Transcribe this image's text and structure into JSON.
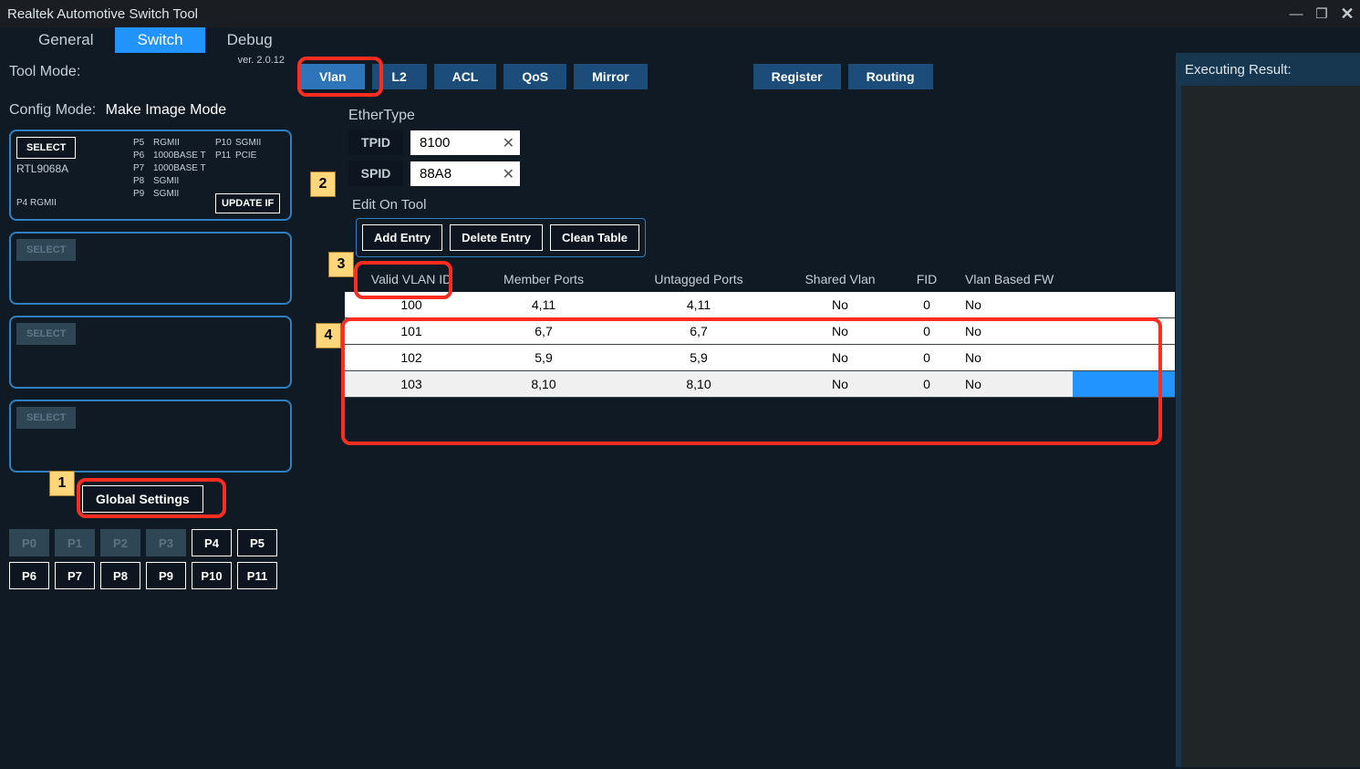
{
  "window": {
    "title": "Realtek Automotive Switch Tool"
  },
  "winbtns": {
    "min": "—",
    "max": "❐",
    "close": "✕"
  },
  "main_tabs": {
    "general": "General",
    "switch": "Switch",
    "debug": "Debug"
  },
  "sidebar": {
    "tool_mode_label": "Tool Mode:",
    "version": "ver. 2.0.12",
    "config_mode_label": "Config Mode:",
    "config_mode_value": "Make Image Mode",
    "select": "SELECT",
    "device": "RTL9068A",
    "p4_row": "P4  RGMII",
    "ports_col": [
      {
        "p": "P5",
        "v": "RGMII"
      },
      {
        "p": "P6",
        "v": "1000BASE T"
      },
      {
        "p": "P7",
        "v": "1000BASE T"
      },
      {
        "p": "P8",
        "v": "SGMII"
      },
      {
        "p": "P9",
        "v": "SGMII"
      }
    ],
    "ports_col2": [
      {
        "p": "P10",
        "v": "SGMII"
      },
      {
        "p": "P11",
        "v": "PCIE"
      }
    ],
    "update_if": "UPDATE IF",
    "global_settings": "Global Settings",
    "port_buttons": [
      "P0",
      "P1",
      "P2",
      "P3",
      "P4",
      "P5",
      "P6",
      "P7",
      "P8",
      "P9",
      "P10",
      "P11"
    ]
  },
  "callouts": {
    "c1": "1",
    "c2": "2",
    "c3": "3",
    "c4": "4"
  },
  "subtabs": {
    "vlan": "Vlan",
    "l2": "L2",
    "acl": "ACL",
    "qos": "QoS",
    "mirror": "Mirror",
    "register": "Register",
    "routing": "Routing"
  },
  "ethertype": {
    "section": "EtherType",
    "tpid_label": "TPID",
    "tpid_value": "8100",
    "spid_label": "SPID",
    "spid_value": "88A8",
    "clear": "✕"
  },
  "edit": {
    "section": "Edit On Tool",
    "add": "Add Entry",
    "delete": "Delete Entry",
    "clean": "Clean Table"
  },
  "table": {
    "headers": {
      "vlan": "Valid VLAN ID",
      "members": "Member Ports",
      "untagged": "Untagged Ports",
      "shared": "Shared Vlan",
      "fid": "FID",
      "fw": "Vlan Based FW"
    },
    "rows": [
      {
        "vlan": "100",
        "members": "4,11",
        "untagged": "4,11",
        "shared": "No",
        "fid": "0",
        "fw": "No"
      },
      {
        "vlan": "101",
        "members": "6,7",
        "untagged": "6,7",
        "shared": "No",
        "fid": "0",
        "fw": "No"
      },
      {
        "vlan": "102",
        "members": "5,9",
        "untagged": "5,9",
        "shared": "No",
        "fid": "0",
        "fw": "No"
      },
      {
        "vlan": "103",
        "members": "8,10",
        "untagged": "8,10",
        "shared": "No",
        "fid": "0",
        "fw": "No"
      }
    ]
  },
  "right": {
    "header": "Executing Result:"
  }
}
